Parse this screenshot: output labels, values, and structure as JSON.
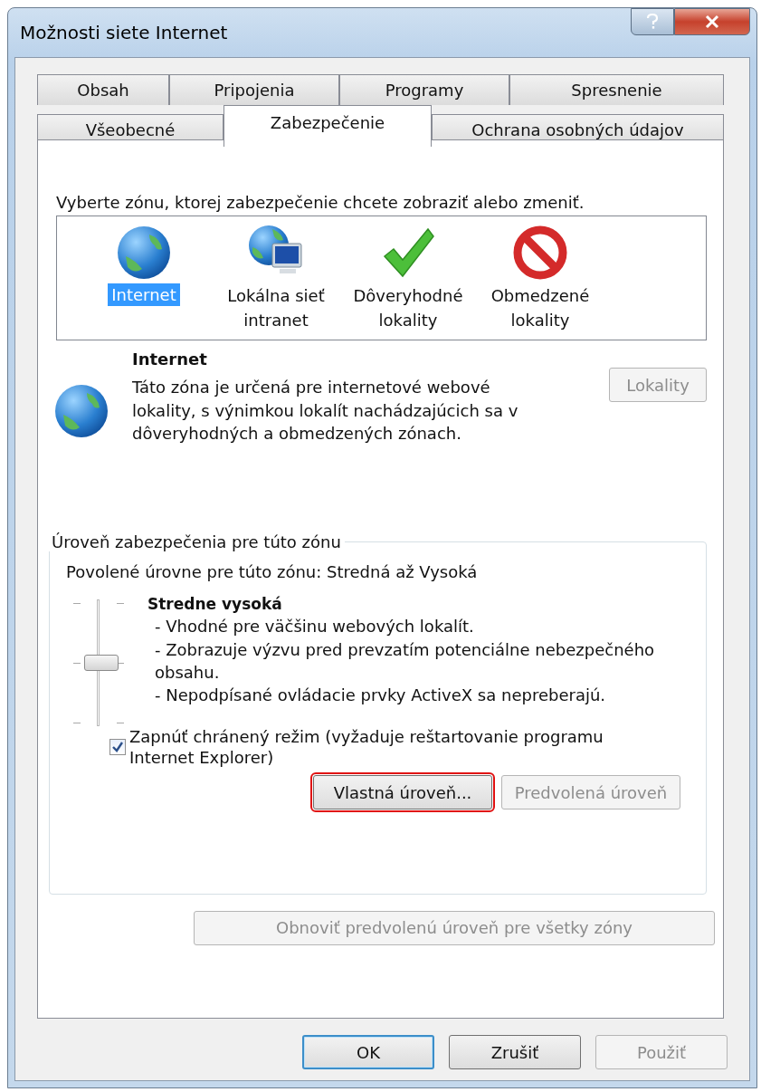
{
  "window": {
    "title": "Možnosti siete Internet"
  },
  "tab_rows": [
    {
      "tabs": [
        {
          "label": "Obsah",
          "selected": false
        },
        {
          "label": "Pripojenia",
          "selected": false
        },
        {
          "label": "Programy",
          "selected": false
        },
        {
          "label": "Spresnenie",
          "selected": false
        }
      ]
    },
    {
      "tabs": [
        {
          "label": "Všeobecné",
          "selected": false
        },
        {
          "label": "Zabezpečenie",
          "selected": true
        },
        {
          "label": "Ochrana osobných údajov",
          "selected": false
        }
      ]
    }
  ],
  "zone_prompt": "Vyberte zónu, ktorej zabezpečenie chcete zobraziť alebo zmeniť.",
  "zones": [
    {
      "kind": "globe",
      "label": "Internet",
      "selected": true
    },
    {
      "kind": "network",
      "label": "Lokálna sieť intranet",
      "selected": false
    },
    {
      "kind": "trusted",
      "label": "Dôveryhodné lokality",
      "selected": false
    },
    {
      "kind": "restricted",
      "label": "Obmedzené lokality",
      "selected": false
    }
  ],
  "zone_info": {
    "title": "Internet",
    "description": "Táto zóna je určená pre internetové webové lokality, s výnimkou lokalít nachádzajúcich sa v dôveryhodných a obmedzených zónach.",
    "button": {
      "label": "Lokality",
      "disabled": true
    }
  },
  "security_level": {
    "legend": "Úroveň zabezpečenia pre túto zónu",
    "allowed": "Povolené úrovne pre túto zónu: Stredná až Vysoká",
    "level": 0.5,
    "level_name": "Stredne vysoká",
    "bullets": [
      "- Vhodné pre väčšinu webových lokalít.",
      "- Zobrazuje výzvu pred prevzatím potenciálne nebezpečného obsahu.",
      "- Nepodpísané ovládacie prvky ActiveX sa nepreberajú."
    ],
    "protected_mode": {
      "label": "Zapnúť chránený režim (vyžaduje reštartovanie programu Internet Explorer)",
      "checked": true
    },
    "buttons": [
      {
        "label": "Vlastná úroveň...",
        "disabled": false,
        "highlighted": true
      },
      {
        "label": "Predvolená úroveň",
        "disabled": true,
        "highlighted": false
      }
    ]
  },
  "reset_button": {
    "label": "Obnoviť predvolenú úroveň pre všetky zóny",
    "disabled": true
  },
  "dialog_buttons": [
    {
      "label": "OK",
      "disabled": false,
      "default": true
    },
    {
      "label": "Zrušiť",
      "disabled": false,
      "default": false
    },
    {
      "label": "Použiť",
      "disabled": true,
      "default": false
    }
  ]
}
